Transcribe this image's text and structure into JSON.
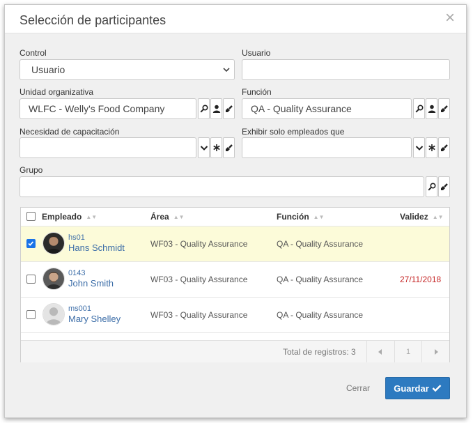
{
  "dialog": {
    "title": "Selección de participantes",
    "close_icon": "×"
  },
  "form": {
    "control": {
      "label": "Control",
      "value": "Usuario"
    },
    "usuario": {
      "label": "Usuario",
      "value": ""
    },
    "unidad": {
      "label": "Unidad organizativa",
      "value": "WLFC - Welly's Food Company"
    },
    "funcion": {
      "label": "Función",
      "value": "QA - Quality Assurance"
    },
    "necesidad": {
      "label": "Necesidad de capacitación",
      "value": ""
    },
    "exhibir": {
      "label": "Exhibir solo empleados que",
      "value": ""
    },
    "grupo": {
      "label": "Grupo",
      "value": ""
    }
  },
  "table": {
    "headers": {
      "empleado": "Empleado",
      "area": "Área",
      "funcion": "Función",
      "validez": "Validez"
    },
    "rows": [
      {
        "code": "hs01",
        "name": "Hans Schmidt",
        "area": "WF03 - Quality Assurance",
        "funcion": "QA - Quality Assurance",
        "validez": "",
        "checked": true
      },
      {
        "code": "0143",
        "name": "John Smith",
        "area": "WF03 - Quality Assurance",
        "funcion": "QA - Quality Assurance",
        "validez": "27/11/2018",
        "checked": false
      },
      {
        "code": "ms001",
        "name": "Mary Shelley",
        "area": "WF03 - Quality Assurance",
        "funcion": "QA - Quality Assurance",
        "validez": "",
        "checked": false
      }
    ],
    "footer": {
      "total": "Total de registros: 3",
      "page": "1"
    }
  },
  "buttons": {
    "cancel": "Cerrar",
    "save": "Guardar"
  },
  "colors": {
    "accent": "#2d7ac0",
    "selected_row": "#fcfbd9",
    "link": "#3d6ea8",
    "expired": "#c62828"
  }
}
